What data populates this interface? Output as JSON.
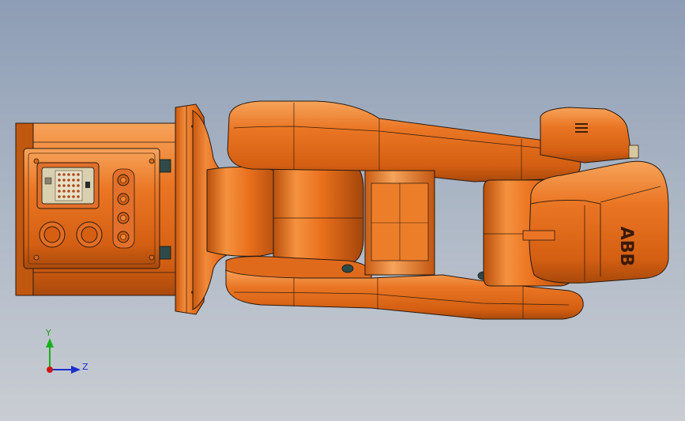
{
  "viewport": {
    "background_top": "#8d9db5",
    "background_bottom": "#c9cdd3"
  },
  "model": {
    "body_color": "#e8701f",
    "body_dark": "#a84a0c",
    "body_light": "#f59a4e",
    "outline_color": "#2a1a10",
    "brand_text": "ABB"
  },
  "triad": {
    "y_label": "Y",
    "z_label": "Z",
    "y_color": "#18b018",
    "z_color": "#1a2fd0",
    "origin_color": "#d01818"
  }
}
